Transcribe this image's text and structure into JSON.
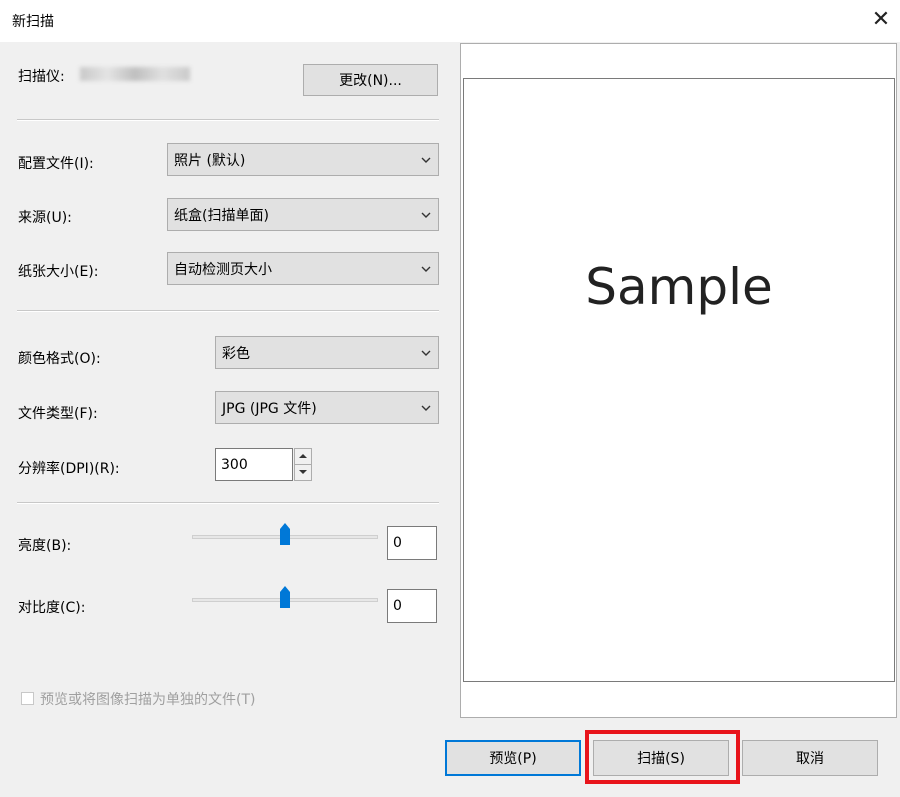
{
  "window": {
    "title": "新扫描",
    "close_glyph": "✕"
  },
  "scanner": {
    "label": "扫描仪:",
    "change_button": "更改(N)..."
  },
  "profile": {
    "label": "配置文件(I):",
    "value": "照片 (默认)"
  },
  "source": {
    "label": "来源(U):",
    "value": "纸盒(扫描单面)"
  },
  "paper_size": {
    "label": "纸张大小(E):",
    "value": "自动检测页大小"
  },
  "color_format": {
    "label": "颜色格式(O):",
    "value": "彩色"
  },
  "file_type": {
    "label": "文件类型(F):",
    "value": "JPG (JPG 文件)"
  },
  "resolution": {
    "label": "分辨率(DPI)(R):",
    "value": "300"
  },
  "brightness": {
    "label": "亮度(B):",
    "value": "0",
    "level": 0.5
  },
  "contrast": {
    "label": "对比度(C):",
    "value": "0",
    "level": 0.5
  },
  "separate_files": {
    "label": "预览或将图像扫描为单独的文件(T)",
    "checked": false
  },
  "preview": {
    "sample_text": "Sample"
  },
  "buttons": {
    "preview": "预览(P)",
    "scan": "扫描(S)",
    "cancel": "取消"
  },
  "colors": {
    "accent": "#0078d7",
    "highlight": "#e8141b"
  },
  "icons": {
    "close": "close-icon",
    "dropdown": "chevron-down-icon",
    "spin_up": "spin-up-icon",
    "spin_down": "spin-down-icon",
    "thumb": "slider-thumb-icon"
  }
}
